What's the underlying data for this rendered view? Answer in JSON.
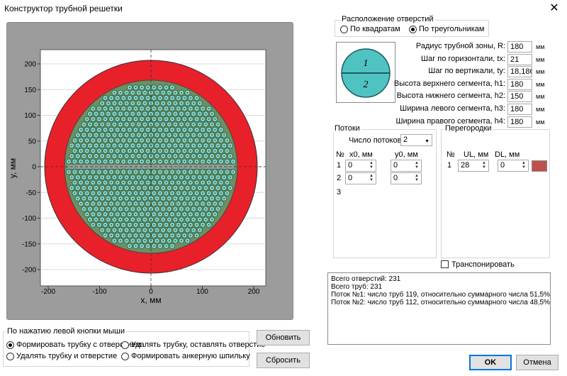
{
  "window": {
    "title": "Конструктор трубной решетки",
    "close_glyph": "✕"
  },
  "plot": {
    "xlabel": "x, мм",
    "ylabel": "y, мм",
    "xticks": [
      "-200",
      "-100",
      "0",
      "100",
      "200"
    ],
    "yticks": [
      "200",
      "150",
      "100",
      "50",
      "0",
      "-50",
      "-100",
      "-150",
      "-200"
    ]
  },
  "layout_group": {
    "label": "Расположение отверстий",
    "options": [
      {
        "label": "По квадратам",
        "selected": false
      },
      {
        "label": "По треугольникам",
        "selected": true
      }
    ]
  },
  "preview": {
    "top_label": "1",
    "bottom_label": "2",
    "fill": "#4fc3c1"
  },
  "params": [
    {
      "label": "Радиус трубной зоны, R:",
      "value": "180",
      "unit": "мм"
    },
    {
      "label": "Шаг по горизонтали, tx:",
      "value": "21",
      "unit": "мм"
    },
    {
      "label": "Шаг по вертикали, ty:",
      "value": "18,1865",
      "unit": "мм"
    },
    {
      "label": "Высота верхнего сегмента, h1:",
      "value": "180",
      "unit": "мм"
    },
    {
      "label": "Высота нижнего сегмента, h2:",
      "value": "150",
      "unit": "мм"
    },
    {
      "label": "Ширина левого сегмента, h3:",
      "value": "180",
      "unit": "мм"
    },
    {
      "label": "Ширина правого сегмента, h4:",
      "value": "180",
      "unit": "мм"
    }
  ],
  "flows": {
    "label": "Потоки",
    "count_label": "Число потоков:",
    "count_value": "2",
    "col_no": "№",
    "col_x0": "x0, мм",
    "col_y0": "y0, мм",
    "rows": [
      {
        "no": "1",
        "x0": "0",
        "y0": "0"
      },
      {
        "no": "2",
        "x0": "0",
        "y0": "0"
      }
    ],
    "extra_no": "3"
  },
  "partitions": {
    "label": "Перегородки",
    "col_no": "№",
    "col_ul": "UL, мм",
    "col_dl": "DL, мм",
    "rows": [
      {
        "no": "1",
        "ul": "28",
        "dl": "0",
        "color": "#c0504d"
      }
    ]
  },
  "transpose": {
    "label": "Транспонировать",
    "checked": false
  },
  "log": {
    "lines": [
      "Всего отверстий: 231",
      "Всего труб: 231",
      "Поток №1: число труб 119, относительно суммарного числа 51,5%",
      "Поток №2: число труб 112, относительно суммарного числа 48,5%"
    ]
  },
  "mouse_group": {
    "label": "По нажатию левой кнопки мыши",
    "options": [
      {
        "label": "Формировать трубку с отверстием",
        "selected": true
      },
      {
        "label": "Удалять трубку, оставлять отверстие",
        "selected": false
      },
      {
        "label": "Удалять трубку и отверстие",
        "selected": false
      },
      {
        "label": "Формировать анкерную шпильку",
        "selected": false
      }
    ]
  },
  "buttons": {
    "refresh": "Обновить",
    "reset": "Сбросить",
    "ok": "OK",
    "cancel": "Отмена"
  },
  "colors": {
    "ring": "#e8202a",
    "tube_fill": "#6b8f6a",
    "tube_hole": "#7fd6d9",
    "accent": "#0078d7"
  }
}
